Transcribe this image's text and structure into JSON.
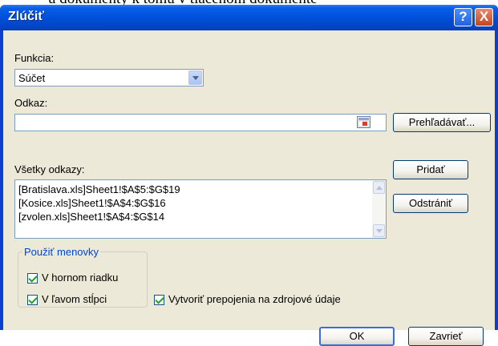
{
  "dialog": {
    "title": "Zlúčiť",
    "help_button": "?",
    "close_button": "X",
    "function_label": "Funkcia:",
    "function_value": "Súčet",
    "reference_label": "Odkaz:",
    "reference_value": "",
    "browse_button": "Prehľadávať...",
    "all_references_label": "Všetky odkazy:",
    "references": [
      "[Bratislava.xls]Sheet1!$A$5:$G$19",
      "[Kosice.xls]Sheet1!$A$4:$G$16",
      "[zvolen.xls]Sheet1!$A$4:$G$14"
    ],
    "add_button": "Pridať",
    "remove_button": "Odstrániť",
    "use_labels_group": "Použiť menovky",
    "top_row_label": "V hornom riadku",
    "top_row_checked": true,
    "left_column_label": "V ľavom stĺpci",
    "left_column_checked": true,
    "create_links_label": "Vytvoriť prepojenia na zdrojové údaje",
    "create_links_checked": true,
    "ok_button": "OK",
    "close_dialog_button": "Zavrieť"
  },
  "colors": {
    "titlebar": "#0051dd",
    "client_bg": "#ece9d8",
    "group_title": "#0046d5",
    "check_mark": "#21a121"
  }
}
